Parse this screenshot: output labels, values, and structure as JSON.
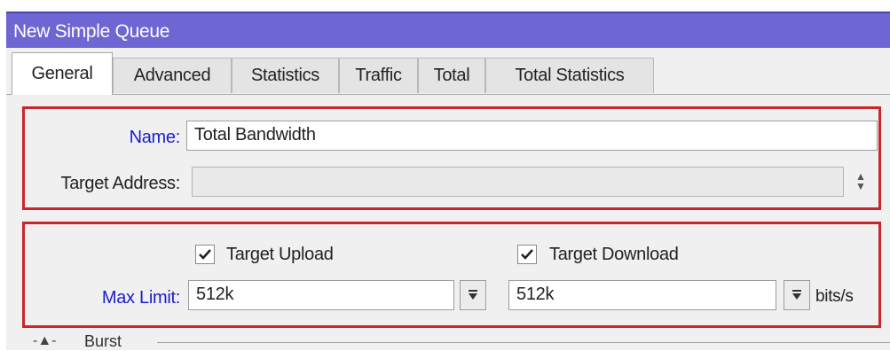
{
  "window": {
    "title": "New Simple Queue"
  },
  "tabs": [
    {
      "label": "General",
      "active": true
    },
    {
      "label": "Advanced"
    },
    {
      "label": "Statistics"
    },
    {
      "label": "Traffic"
    },
    {
      "label": "Total"
    },
    {
      "label": "Total Statistics"
    }
  ],
  "general": {
    "name_label": "Name:",
    "name_value": "Total Bandwidth",
    "target_address_label": "Target Address:",
    "target_address_value": "",
    "target_upload_label": "Target Upload",
    "target_upload_checked": true,
    "target_download_label": "Target Download",
    "target_download_checked": true,
    "max_limit_label": "Max Limit:",
    "max_limit_upload": "512k",
    "max_limit_download": "512k",
    "max_limit_unit": "bits/s",
    "burst_label": "Burst"
  },
  "colors": {
    "title_bar": "#6e66d2",
    "highlight_box": "#c9262d",
    "label_blue": "#1c1ccf"
  },
  "icons": {
    "checkbox": "check-mark",
    "spinner": "up-down-arrows",
    "dropdown": "down-arrow-with-bar",
    "collapse": "triangle-up"
  }
}
